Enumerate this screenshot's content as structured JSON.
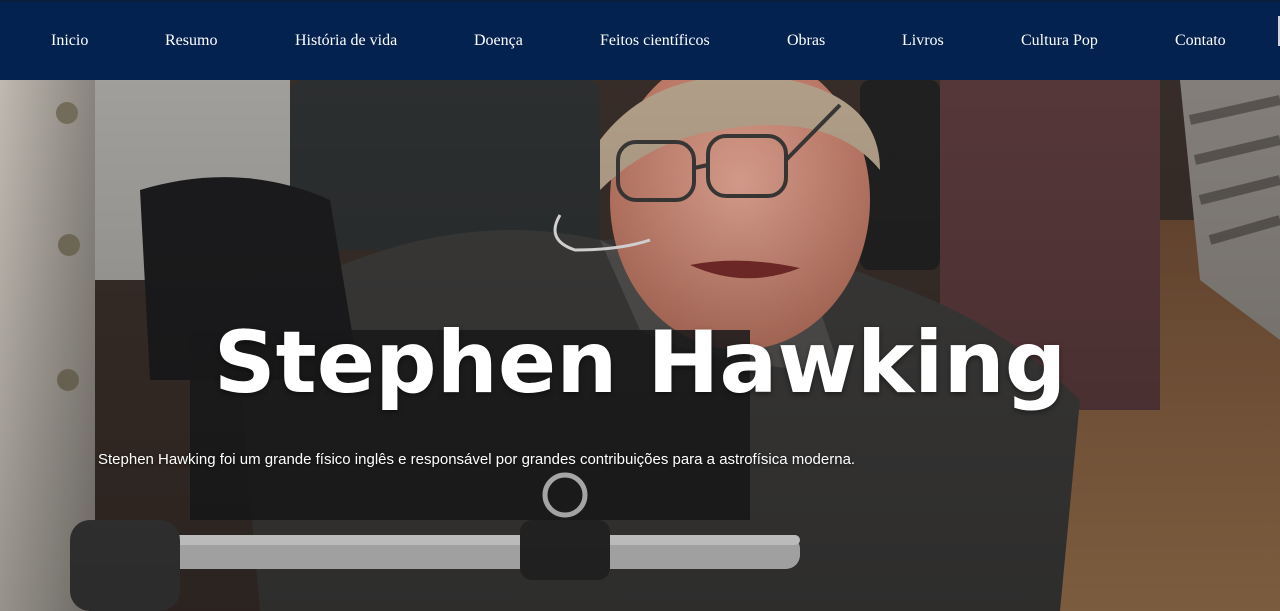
{
  "nav": {
    "items": [
      {
        "label": "Inicio"
      },
      {
        "label": "Resumo"
      },
      {
        "label": "História de vida"
      },
      {
        "label": "Doença"
      },
      {
        "label": "Feitos científicos"
      },
      {
        "label": "Obras"
      },
      {
        "label": "Livros"
      },
      {
        "label": "Cultura Pop"
      },
      {
        "label": "Contato"
      }
    ]
  },
  "hero": {
    "title": "Stephen Hawking",
    "subtitle": "Stephen Hawking foi um grande físico inglês e responsável por grandes contribuições para a astrofísica moderna."
  },
  "colors": {
    "nav_background": "#03224f",
    "nav_text": "#ffffff",
    "hero_text": "#ffffff"
  }
}
